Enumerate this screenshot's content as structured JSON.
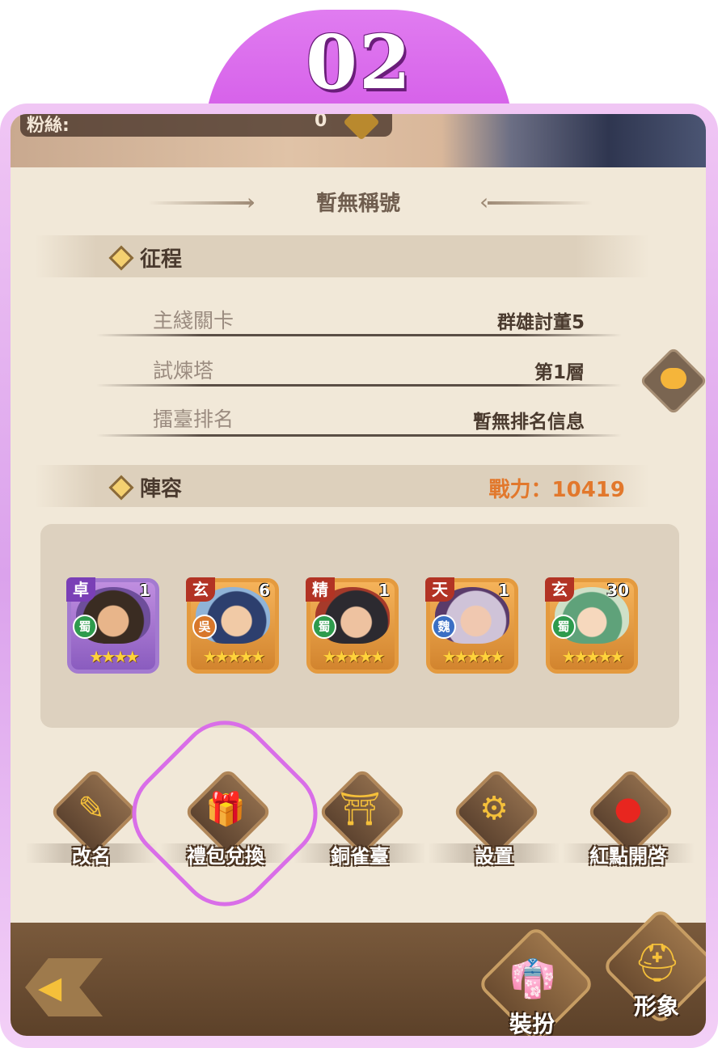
{
  "step_number": "02",
  "banner": {
    "label": "粉絲:",
    "value": "0"
  },
  "title": "暫無稱號",
  "journey": {
    "heading": "征程",
    "rows": [
      {
        "label": "主綫關卡",
        "value": "群雄討董5"
      },
      {
        "label": "試煉塔",
        "value": "第1層"
      },
      {
        "label": "擂臺排名",
        "value": "暫無排名信息"
      }
    ]
  },
  "lineup": {
    "heading": "陣容",
    "power_label": "戰力：10419",
    "heroes": [
      {
        "grade": "卓",
        "level": "1",
        "faction": "蜀",
        "stars": "★★★★",
        "frame": "purple"
      },
      {
        "grade": "玄",
        "level": "6",
        "faction": "吳",
        "stars": "★★★★★",
        "frame": "orange"
      },
      {
        "grade": "精",
        "level": "1",
        "faction": "蜀",
        "stars": "★★★★★",
        "frame": "orange"
      },
      {
        "grade": "天",
        "level": "1",
        "faction": "魏",
        "stars": "★★★★★",
        "frame": "orange"
      },
      {
        "grade": "玄",
        "level": "30",
        "faction": "蜀",
        "stars": "★★★★★",
        "frame": "orange"
      }
    ]
  },
  "menu": [
    {
      "label": "改名",
      "icon": "edit-icon",
      "glyph": "✎"
    },
    {
      "label": "禮包兌換",
      "icon": "gift-icon",
      "glyph": "🎁"
    },
    {
      "label": "銅雀臺",
      "icon": "pavilion-icon",
      "glyph": "⛩"
    },
    {
      "label": "設置",
      "icon": "gear-icon",
      "glyph": "⚙"
    },
    {
      "label": "紅點開啓",
      "icon": "red-dot-icon",
      "glyph": "●"
    }
  ],
  "bottom_bar": {
    "dress_label": "裝扮",
    "appearance_label": "形象"
  },
  "colors": {
    "accent_purple": "#d96ee8",
    "power_orange": "#e2782c",
    "gold": "#f5c03a"
  }
}
